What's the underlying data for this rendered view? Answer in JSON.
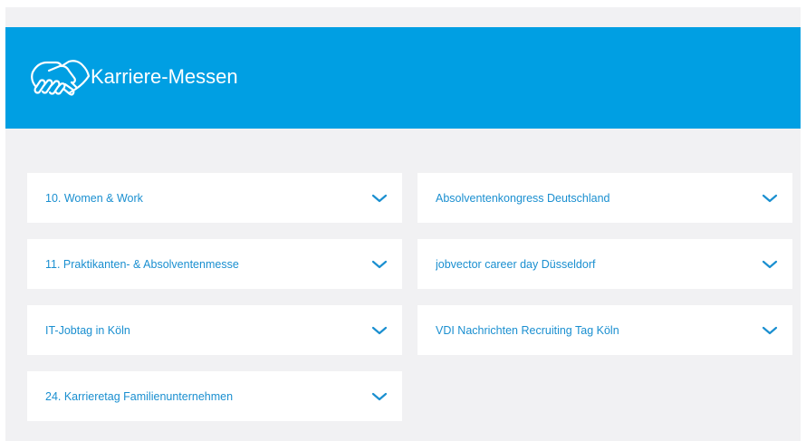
{
  "header": {
    "title": "Karriere-Messen",
    "icon": "handshake-icon"
  },
  "colors": {
    "accent": "#009fe3",
    "link": "#1a8fd0",
    "background": "#f1f1f3",
    "card": "#ffffff"
  },
  "accordion": {
    "left": [
      {
        "label": "10. Women & Work"
      },
      {
        "label": "11. Praktikanten- & Absolventenmesse"
      },
      {
        "label": "IT-Jobtag in Köln"
      },
      {
        "label": "24. Karrieretag Familienunternehmen"
      }
    ],
    "right": [
      {
        "label": "Absolventenkongress Deutschland"
      },
      {
        "label": "jobvector career day Düsseldorf"
      },
      {
        "label": "VDI Nachrichten Recruiting Tag Köln"
      }
    ]
  }
}
